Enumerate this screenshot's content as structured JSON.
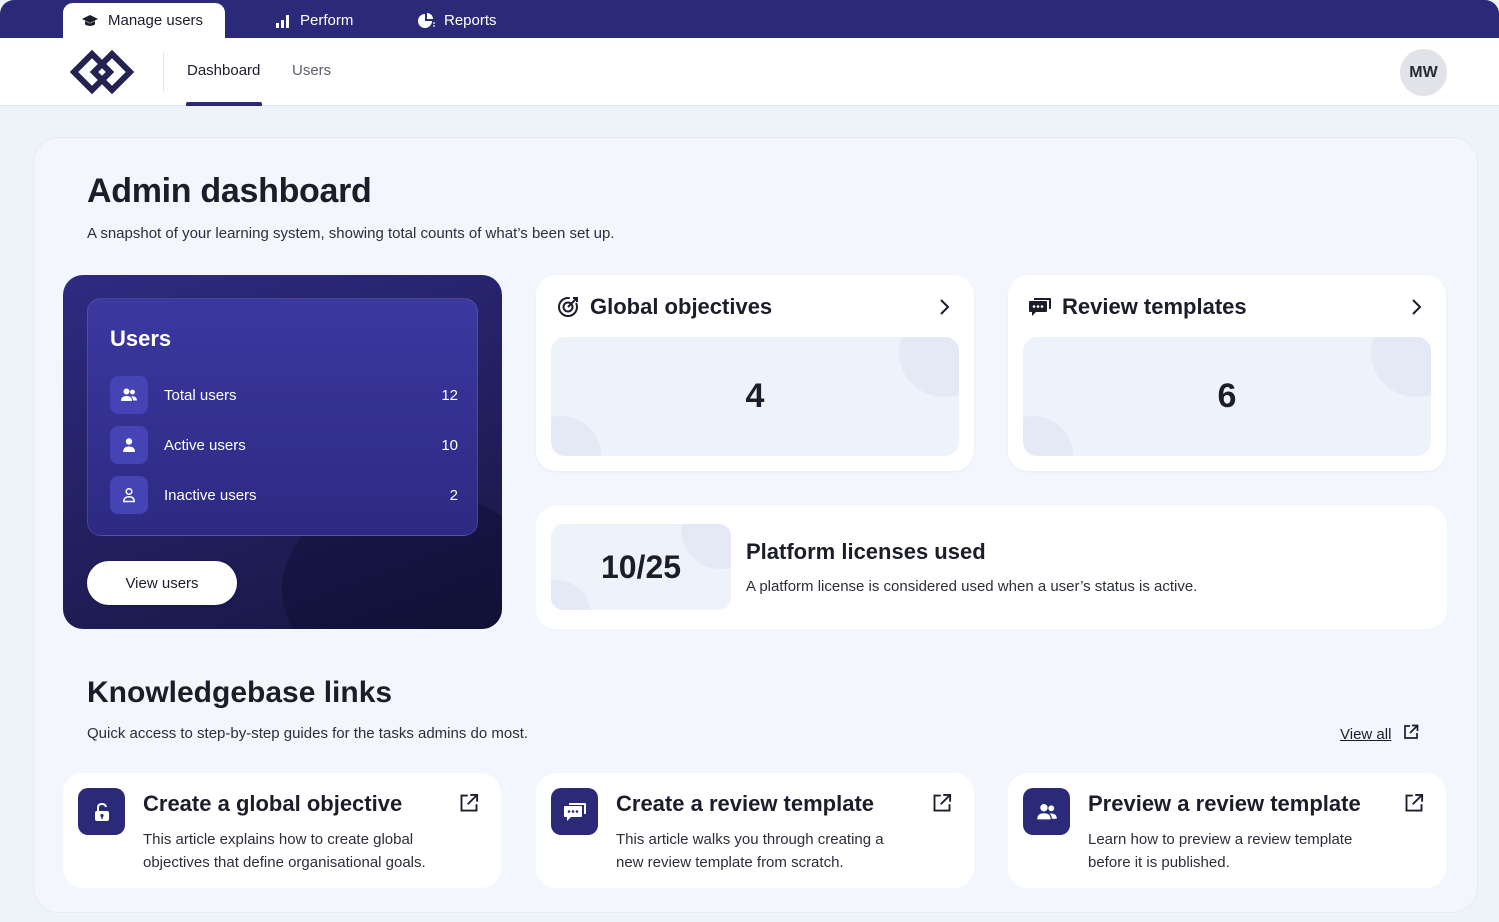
{
  "top_tabs": [
    {
      "label": "Manage users",
      "icon": "graduation-cap-icon"
    },
    {
      "label": "Perform",
      "icon": "bar-chart-icon"
    },
    {
      "label": "Reports",
      "icon": "pie-chart-icon"
    }
  ],
  "header": {
    "nav": [
      {
        "label": "Dashboard"
      },
      {
        "label": "Users"
      }
    ],
    "avatar_initials": "MW"
  },
  "page": {
    "title": "Admin dashboard",
    "subtitle": "A snapshot of your learning system, showing total counts of what’s been set up."
  },
  "users_card": {
    "title": "Users",
    "rows": [
      {
        "label": "Total users",
        "value": "12",
        "icon": "users-group-icon"
      },
      {
        "label": "Active users",
        "value": "10",
        "icon": "user-filled-icon"
      },
      {
        "label": "Inactive users",
        "value": "2",
        "icon": "user-outline-icon"
      }
    ],
    "button": "View users"
  },
  "global_objectives": {
    "title": "Global objectives",
    "value": "4",
    "icon": "target-icon"
  },
  "review_templates": {
    "title": "Review templates",
    "value": "6",
    "icon": "chat-bubbles-icon"
  },
  "licenses": {
    "value": "10/25",
    "title": "Platform licenses used",
    "description": "A platform license is considered used when a user’s status is active."
  },
  "knowledgebase": {
    "title": "Knowledgebase links",
    "subtitle": "Quick access to step-by-step guides for the tasks admins do most.",
    "view_all": "View all",
    "cards": [
      {
        "title": "Create a global objective",
        "description": "This article explains how to create global objectives that define organisational goals.",
        "icon": "unlock-icon"
      },
      {
        "title": "Create a review template",
        "description": "This article walks you through creating a new review template from scratch.",
        "icon": "chat-bubbles-icon"
      },
      {
        "title": "Preview a review template",
        "description": "Learn how to preview a review template before it is published.",
        "icon": "users-group-icon"
      }
    ]
  },
  "colors": {
    "brand": "#2b2a78",
    "background": "#eef2f9",
    "card": "#ffffff"
  }
}
